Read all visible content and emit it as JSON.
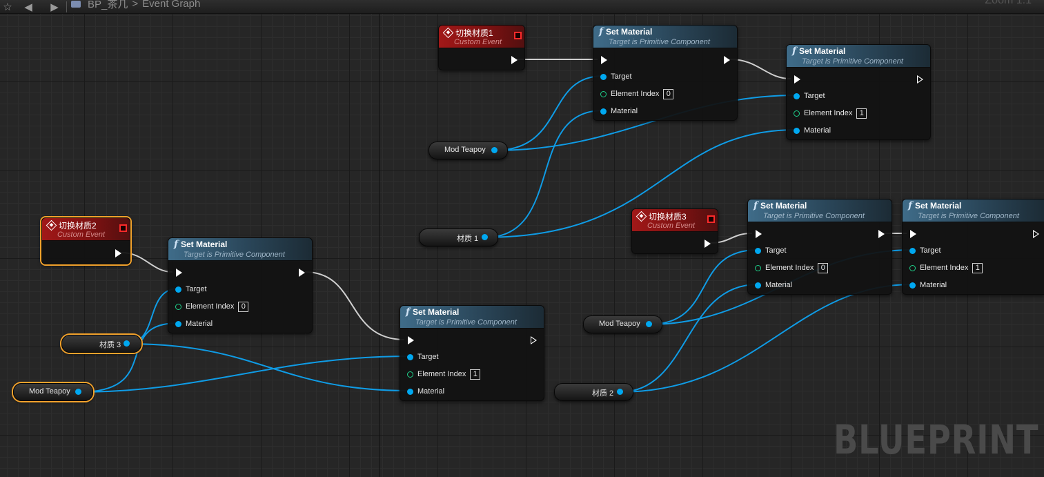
{
  "breadcrumb": {
    "blueprint": "BP_茶几",
    "separator": ">",
    "graph": "Event Graph"
  },
  "zoom_label": "Zoom 1:1",
  "watermark": "BLUEPRINT",
  "colors": {
    "exec_wire": "#d0d0d0",
    "object_wire": "#0f9ce6",
    "selection": "#f2a22c",
    "event_header": "#a11818",
    "function_header": "#3f6c89"
  },
  "events": [
    {
      "title": "切换材质1",
      "subtitle": "Custom Event"
    },
    {
      "title": "切换材质2",
      "subtitle": "Custom Event"
    },
    {
      "title": "切换材质3",
      "subtitle": "Custom Event"
    }
  ],
  "set_material": {
    "title": "Set Material",
    "subtitle": "Target is Primitive Component",
    "pins": {
      "target": "Target",
      "element_index": "Element Index",
      "material": "Material"
    },
    "nodes": [
      {
        "element_index": "0"
      },
      {
        "element_index": "1"
      },
      {
        "element_index": "0"
      },
      {
        "element_index": "1"
      },
      {
        "element_index": "0"
      },
      {
        "element_index": "1"
      }
    ]
  },
  "variables": [
    {
      "label": "Mod Teapoy"
    },
    {
      "label": "材质 1"
    },
    {
      "label": "材质 3"
    },
    {
      "label": "Mod Teapoy"
    },
    {
      "label": "Mod Teapoy"
    },
    {
      "label": "材质 2"
    }
  ]
}
